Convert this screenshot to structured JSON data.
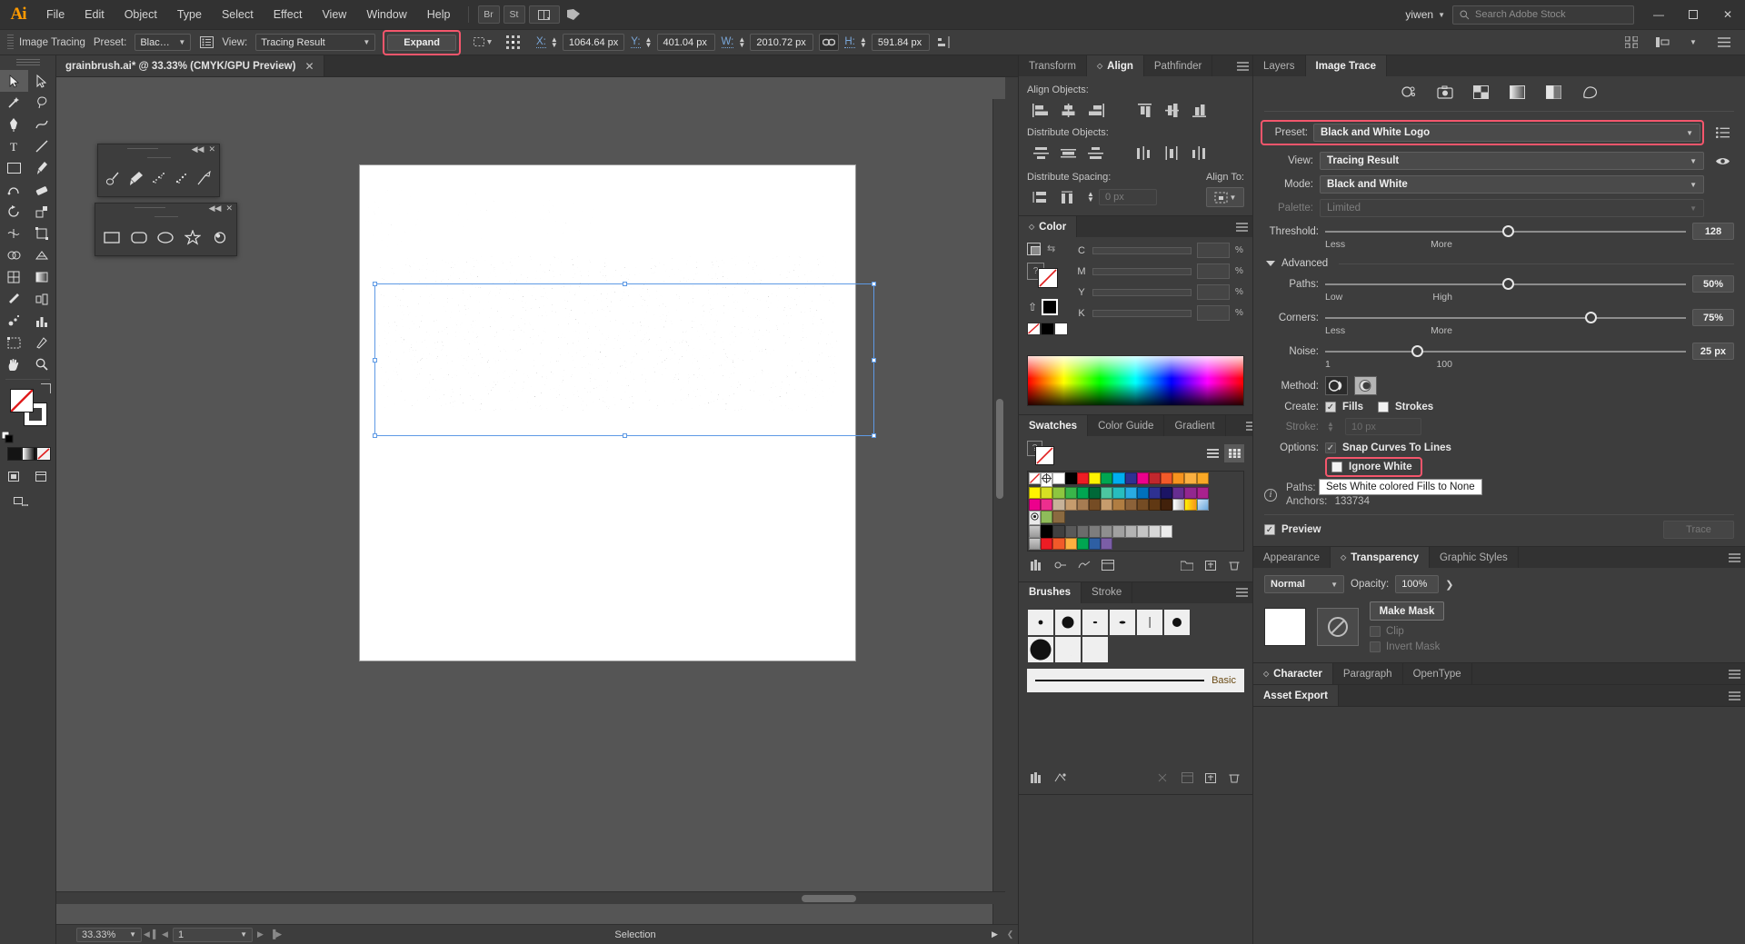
{
  "app": {
    "name": "Adobe Illustrator",
    "logo_text": "Ai",
    "menus": [
      "File",
      "Edit",
      "Object",
      "Type",
      "Select",
      "Effect",
      "View",
      "Window",
      "Help"
    ],
    "quick_buttons": [
      "Br",
      "St"
    ],
    "user_name": "yiwen",
    "search_placeholder": "Search Adobe Stock",
    "window_buttons": {
      "minimize": "—",
      "maximize": "❐",
      "close": "✕"
    }
  },
  "control_bar": {
    "context_label": "Image Tracing",
    "preset_label": "Preset:",
    "preset_value": "Black a...",
    "panel_icon": "list-icon",
    "view_label": "View:",
    "view_value": "Tracing Result",
    "expand_button": "Expand",
    "highlight_color": "#f4566c",
    "transform_fields": [
      {
        "label": "X:",
        "value": "1064.64 px"
      },
      {
        "label": "Y:",
        "value": "401.04 px"
      },
      {
        "label": "W:",
        "value": "2010.72 px"
      },
      {
        "label": "H:",
        "value": "591.84 px"
      }
    ],
    "link_icon": "chain-link-icon",
    "align_icons": [
      "align-left-icon",
      "distribute-icon",
      "panel-menu-icon"
    ]
  },
  "toolbar": {
    "tools": [
      [
        "selection-tool",
        "direct-selection-tool"
      ],
      [
        "magic-wand-tool",
        "lasso-tool"
      ],
      [
        "pen-tool",
        "curvature-tool"
      ],
      [
        "type-tool",
        "line-segment-tool"
      ],
      [
        "rectangle-tool",
        "ellipse-tool"
      ],
      [
        "paintbrush-tool",
        "shaper-tool"
      ],
      [
        "pencil-tool",
        "eraser-tool"
      ],
      [
        "rotate-tool",
        "scale-tool"
      ],
      [
        "width-tool",
        "free-transform-tool"
      ],
      [
        "shape-builder-tool",
        "perspective-grid-tool"
      ],
      [
        "mesh-tool",
        "gradient-tool"
      ],
      [
        "eyedropper-tool",
        "blend-tool"
      ],
      [
        "symbol-sprayer-tool",
        "column-graph-tool"
      ],
      [
        "artboard-tool",
        "slice-tool"
      ],
      [
        "hand-tool",
        "zoom-tool"
      ]
    ],
    "fill_swatch": "none-fill",
    "stroke_swatch": "black-stroke",
    "screen_mode": "change-screen-mode"
  },
  "document": {
    "tab_title": "grainbrush.ai* @ 33.33% (CMYK/GPU Preview)",
    "close_icon": "✕"
  },
  "floating_palettes": [
    {
      "name": "brushes-flyout",
      "items": [
        "blob-brush",
        "paintbrush",
        "grain-brush-1",
        "grain-brush-2",
        "scatter-brush"
      ]
    },
    {
      "name": "shapes-flyout",
      "items": [
        "rectangle",
        "rounded-rectangle",
        "ellipse",
        "star",
        "flare"
      ]
    }
  ],
  "status_bar": {
    "zoom": "33.33%",
    "page": "1",
    "tool": "Selection",
    "nav_first": "◀▐",
    "nav_prev": "◀",
    "nav_next": "▶",
    "nav_last": "▐▶"
  },
  "panels": {
    "group_a_top": {
      "tabs": [
        "Transform",
        "Align",
        "Pathfinder"
      ],
      "active": "Align",
      "align_objects_label": "Align Objects:",
      "distribute_objects_label": "Distribute Objects:",
      "distribute_spacing_label": "Distribute Spacing:",
      "align_to_label": "Align To:",
      "spacing_value": "0 px",
      "palette_icon": "align-to-selection-icon"
    },
    "color": {
      "title": "Color",
      "channels": [
        {
          "label": "C",
          "value": "",
          "unit": "%"
        },
        {
          "label": "M",
          "value": "",
          "unit": "%"
        },
        {
          "label": "Y",
          "value": "",
          "unit": "%"
        },
        {
          "label": "K",
          "value": "",
          "unit": "%"
        }
      ]
    },
    "swatches": {
      "tabs": [
        "Swatches",
        "Color Guide",
        "Gradient"
      ],
      "active": "Swatches",
      "view_icons": [
        "list-view-icon",
        "grid-view-icon"
      ],
      "rows": [
        [
          "none",
          "registration",
          "#ffffff",
          "#000000",
          "#ed1c24",
          "#fff200",
          "#00a651",
          "#00aeef",
          "#2e3192",
          "#ec008c",
          "#c1272d",
          "#f15a29",
          "#f7941e",
          "#fbb040",
          "#f9a825",
          "",
          ""
        ],
        [
          "#fff200",
          "#d7df23",
          "#8dc63f",
          "#39b54a",
          "#00a651",
          "#006838",
          "#4cc6a0",
          "#27bdbe",
          "#29abe2",
          "#0071bc",
          "#2e3192",
          "#1b1464",
          "#662d91",
          "#92278f",
          "#a9218e",
          "",
          ""
        ],
        [
          "#ec008c",
          "#ed2e8e",
          "#c7b299",
          "#c69c6d",
          "#a67c52",
          "#754c24",
          "#c69c6d",
          "#b07d42",
          "#8c6239",
          "#754c24",
          "#603813",
          "#42210b",
          "#d9d9d9",
          "#fbb040",
          "#9fc6e8",
          "",
          ""
        ],
        [
          "pattern-dot",
          "pattern-leaf",
          "pattern-wood",
          "",
          "",
          "",
          "",
          "",
          "",
          "",
          "",
          "",
          "",
          "",
          "",
          "",
          ""
        ],
        [
          "gray-tint",
          "#000000",
          "#404040",
          "#595959",
          "#6b6b6b",
          "#7d7d7d",
          "#8f8f8f",
          "#a1a1a1",
          "#b3b3b3",
          "#c5c5c5",
          "#d7d7d7",
          "#ececec",
          "",
          "",
          "",
          "",
          ""
        ],
        [
          "gray-tint",
          "#ed1c24",
          "#f15a29",
          "#fbb040",
          "#00a651",
          "#2e5fa3",
          "#7b5ea7",
          "",
          "",
          "",
          "",
          "",
          "",
          "",
          "",
          "",
          ""
        ]
      ],
      "tools": [
        "swatch-libraries-icon",
        "show-swatch-kinds-icon",
        "swatch-options-icon",
        "new-color-group-icon",
        "new-swatch-icon",
        "delete-swatch-icon"
      ]
    },
    "brushes": {
      "tabs": [
        "Brushes",
        "Stroke"
      ],
      "active": "Brushes",
      "items": [
        "dot-small",
        "dot-large",
        "speck-1",
        "speck-2",
        "hairline",
        "dot-round",
        "dot-xlarge",
        "grain-dense",
        "grain-sparse"
      ],
      "stroke_preview_label": "Basic",
      "tools": [
        "brush-libraries-icon",
        "libraries-icon",
        "remove-brush-stroke-icon",
        "brush-options-icon",
        "new-brush-icon",
        "delete-brush-icon"
      ]
    },
    "layers_group": {
      "tabs": [
        "Layers",
        "Image Trace"
      ],
      "active": "Image Trace"
    },
    "image_trace": {
      "mode_icons": [
        "auto-color-icon",
        "high-color-icon",
        "low-color-icon",
        "grayscale-icon",
        "black-and-white-icon",
        "outline-icon"
      ],
      "preset_label": "Preset:",
      "preset_value": "Black and White Logo",
      "preset_menu_icon": "preset-menu-icon",
      "preset_highlighted": true,
      "view_label": "View:",
      "view_value": "Tracing Result",
      "view_eye_icon": "eye-icon",
      "mode_label": "Mode:",
      "mode_value": "Black and White",
      "palette_label": "Palette:",
      "palette_value": "Limited",
      "threshold_label": "Threshold:",
      "threshold_value": "128",
      "threshold_min": "Less",
      "threshold_max": "More",
      "advanced_label": "Advanced",
      "paths_label": "Paths:",
      "paths_value": "50%",
      "paths_min": "Low",
      "paths_max": "High",
      "corners_label": "Corners:",
      "corners_value": "75%",
      "corners_min": "Less",
      "corners_max": "More",
      "noise_label": "Noise:",
      "noise_value": "25 px",
      "noise_min": "1",
      "noise_max": "100",
      "method_label": "Method:",
      "method_options": [
        "abutting-method-icon",
        "overlapping-method-icon"
      ],
      "create_label": "Create:",
      "create_fills": "Fills",
      "create_strokes": "Strokes",
      "stroke_label": "Stroke:",
      "stroke_value": "10 px",
      "options_label": "Options:",
      "snap_curves": "Snap Curves To Lines",
      "ignore_white": "Ignore White",
      "ignore_white_highlighted": true,
      "tooltip_text": "Sets White colored Fills to None",
      "paths_count_label": "Paths:",
      "anchors_label": "Anchors:",
      "anchors_value": "133734",
      "preview_label": "Preview",
      "trace_button": "Trace"
    },
    "transparency": {
      "tabs": [
        "Appearance",
        "Transparency",
        "Graphic Styles"
      ],
      "active": "Transparency",
      "blend_mode": "Normal",
      "opacity_label": "Opacity:",
      "opacity_value": "100%",
      "make_mask_button": "Make Mask",
      "clip_label": "Clip",
      "invert_mask_label": "Invert Mask"
    },
    "character_group": {
      "tabs": [
        "Character",
        "Paragraph",
        "OpenType"
      ],
      "active": "Character"
    },
    "asset_export": {
      "tabs": [
        "Asset Export"
      ],
      "active": "Asset Export"
    }
  }
}
